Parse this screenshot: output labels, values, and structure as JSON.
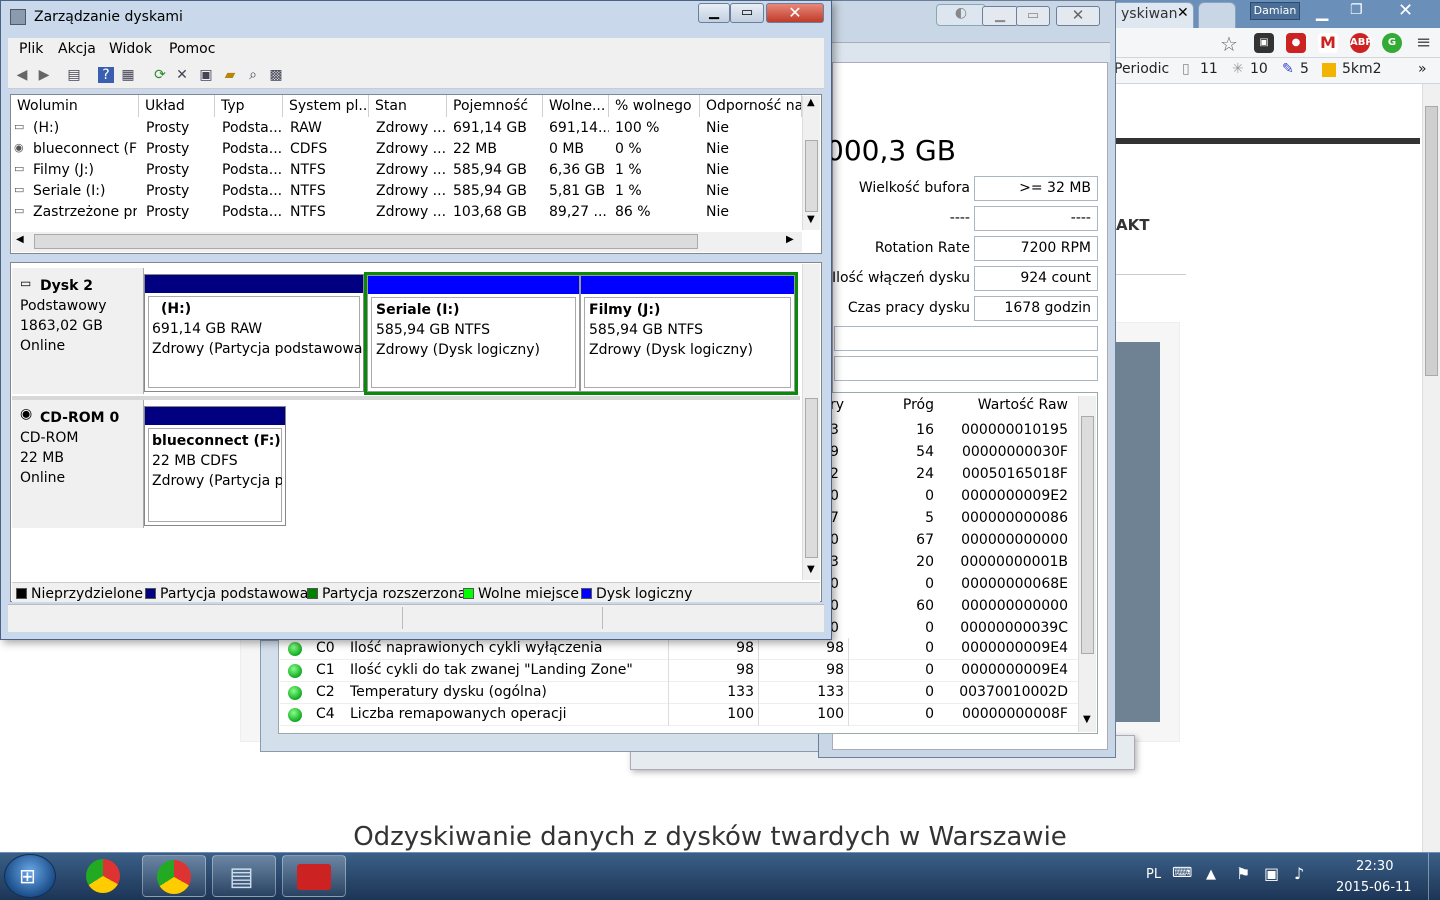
{
  "browser": {
    "tab_text": "yskiwan",
    "profile": "Damian",
    "bookmarks": [
      "Periodic",
      "11",
      "10",
      "5",
      "5km2"
    ],
    "more": "»",
    "page": {
      "heading": "Odzyskiwanie danych z dysków twardych w Warszawie",
      "partial_text": "AKT"
    }
  },
  "disk_tool": {
    "capacity_partial": "000,3 GB",
    "fields": [
      {
        "label": "Wielkość bufora",
        "value": ">= 32 MB"
      },
      {
        "label": "----",
        "value": "----"
      },
      {
        "label": "Rotation Rate",
        "value": "7200 RPM"
      },
      {
        "label": "Ilość włączeń dysku",
        "value": "924 count"
      },
      {
        "label": "Czas pracy dysku",
        "value": "1678 godzin"
      }
    ],
    "smart": {
      "headers": [
        "ry",
        "Próg",
        "Wartość Raw"
      ],
      "partial_rows": [
        {
          "worst": "3",
          "threshold": "16",
          "raw": "000000010195"
        },
        {
          "worst": "9",
          "threshold": "54",
          "raw": "00000000030F"
        },
        {
          "worst": "2",
          "threshold": "24",
          "raw": "00050165018F"
        },
        {
          "worst": "0",
          "threshold": "0",
          "raw": "0000000009E2"
        },
        {
          "worst": "7",
          "threshold": "5",
          "raw": "000000000086"
        },
        {
          "worst": "0",
          "threshold": "67",
          "raw": "000000000000"
        },
        {
          "worst": "3",
          "threshold": "20",
          "raw": "00000000001B"
        },
        {
          "worst": "0",
          "threshold": "0",
          "raw": "00000000068E"
        },
        {
          "worst": "0",
          "threshold": "60",
          "raw": "000000000000"
        },
        {
          "worst": "0",
          "threshold": "0",
          "raw": "00000000039C"
        }
      ],
      "full_rows": [
        {
          "id": "C0",
          "name": "Ilość naprawionych cykli wyłączenia",
          "current": "98",
          "worst": "98",
          "threshold": "0",
          "raw": "0000000009E4"
        },
        {
          "id": "C1",
          "name": "Ilość cykli do tak zwanej \"Landing Zone\"",
          "current": "98",
          "worst": "98",
          "threshold": "0",
          "raw": "0000000009E4"
        },
        {
          "id": "C2",
          "name": "Temperatury dysku (ogólna)",
          "current": "133",
          "worst": "133",
          "threshold": "0",
          "raw": "00370010002D"
        },
        {
          "id": "C4",
          "name": "Liczba remapowanych operacji",
          "current": "100",
          "worst": "100",
          "threshold": "0",
          "raw": "00000000008F"
        }
      ]
    }
  },
  "disk_mgmt": {
    "title": "Zarządzanie dyskami",
    "menu": [
      "Plik",
      "Akcja",
      "Widok",
      "Pomoc"
    ],
    "columns": [
      "Wolumin",
      "Układ",
      "Typ",
      "System pl...",
      "Stan",
      "Pojemność",
      "Wolne...",
      "% wolnego",
      "Odporność na"
    ],
    "volumes": [
      [
        "(H:)",
        "Prosty",
        "Podsta...",
        "RAW",
        "Zdrowy ...",
        "691,14 GB",
        "691,14...",
        "100 %",
        "Nie"
      ],
      [
        "blueconnect (F:)",
        "Prosty",
        "Podsta...",
        "CDFS",
        "Zdrowy ...",
        "22 MB",
        "0 MB",
        "0 %",
        "Nie"
      ],
      [
        "Filmy (J:)",
        "Prosty",
        "Podsta...",
        "NTFS",
        "Zdrowy ...",
        "585,94 GB",
        "6,36 GB",
        "1 %",
        "Nie"
      ],
      [
        "Seriale (I:)",
        "Prosty",
        "Podsta...",
        "NTFS",
        "Zdrowy ...",
        "585,94 GB",
        "5,81 GB",
        "1 %",
        "Nie"
      ],
      [
        "Zastrzeżone pr...",
        "Prosty",
        "Podsta...",
        "NTFS",
        "Zdrowy ...",
        "103,68 GB",
        "89,27 ...",
        "86 %",
        "Nie"
      ]
    ],
    "disks": [
      {
        "name": "Dysk 2",
        "kind": "Podstawowy",
        "size": "1863,02 GB",
        "status": "Online",
        "partitions": [
          {
            "title": "(H:)",
            "detail": "691,14 GB RAW",
            "health": "Zdrowy (Partycja podstawowa)"
          },
          {
            "title": "Seriale  (I:)",
            "detail": "585,94 GB NTFS",
            "health": "Zdrowy (Dysk logiczny)"
          },
          {
            "title": "Filmy  (J:)",
            "detail": "585,94 GB NTFS",
            "health": "Zdrowy (Dysk logiczny)"
          }
        ]
      },
      {
        "name": "CD-ROM 0",
        "kind": "CD-ROM",
        "size": "22 MB",
        "status": "Online",
        "partitions": [
          {
            "title": "blueconnect  (F:)",
            "detail": "22 MB CDFS",
            "health": "Zdrowy (Partycja p"
          }
        ]
      }
    ],
    "legend": [
      {
        "label": "Nieprzydzielone",
        "color": "#000000"
      },
      {
        "label": "Partycja podstawowa",
        "color": "#000080"
      },
      {
        "label": "Partycja rozszerzona",
        "color": "#008000"
      },
      {
        "label": "Wolne miejsce",
        "color": "#00ff00"
      },
      {
        "label": "Dysk logiczny",
        "color": "#0000ff"
      }
    ],
    "colors": {
      "primary": "#000080",
      "logical": "#0000ff",
      "extended": "#008000"
    }
  },
  "taskbar": {
    "language": "PL",
    "time": "22:30",
    "date": "2015-06-11"
  }
}
